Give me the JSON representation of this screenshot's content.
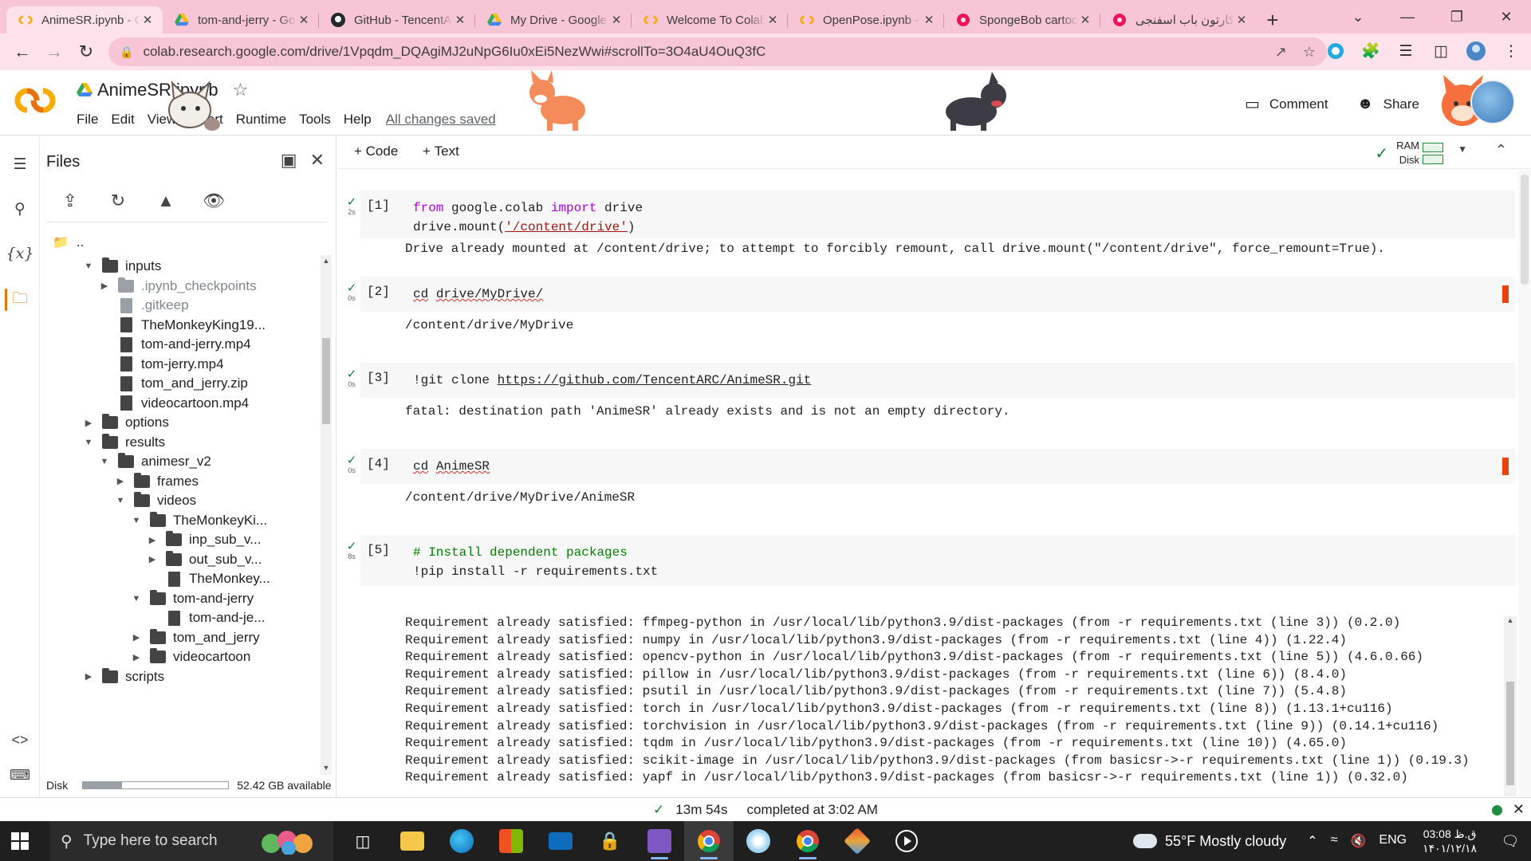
{
  "browser": {
    "tabs": [
      {
        "title": "AnimeSR.ipynb - Colaboratory",
        "icon": "colab-icon",
        "active": true
      },
      {
        "title": "tom-and-jerry - Google Drive",
        "icon": "google-drive-icon",
        "active": false
      },
      {
        "title": "GitHub - TencentARC/AnimeSR",
        "icon": "github-icon",
        "active": false
      },
      {
        "title": "My Drive - Google Drive",
        "icon": "google-drive-icon",
        "active": false
      },
      {
        "title": "Welcome To Colaboratory",
        "icon": "colab-icon",
        "active": false
      },
      {
        "title": "OpenPose.ipynb - Colaboratory",
        "icon": "colab-icon",
        "active": false
      },
      {
        "title": "SpongeBob cartoon",
        "icon": "aparat-icon",
        "active": false
      },
      {
        "title": "کارتون باب اسفنجی",
        "icon": "aparat-icon",
        "active": false
      }
    ],
    "tab_close_glyph": "✕",
    "new_tab_glyph": "+",
    "url": "colab.research.google.com/drive/1Vpqdm_DQAgiMJ2uNpG6Iu0xEi5NezWwi#scrollTo=3O4aU4OuQ3fC",
    "window_controls": [
      "⌄",
      "—",
      "❐",
      "✕"
    ]
  },
  "colab": {
    "notebook_title": "AnimeSR.ipynb",
    "menu": [
      "File",
      "Edit",
      "View",
      "Insert",
      "Runtime",
      "Tools",
      "Help"
    ],
    "save_status": "All changes saved",
    "comment_label": "Comment",
    "share_label": "Share",
    "add_code_label": "Code",
    "add_text_label": "Text",
    "ram_label": "RAM",
    "disk_label": "Disk",
    "accent_color": "#f9ab00"
  },
  "files_panel": {
    "title": "Files",
    "parent_dir": "..",
    "tree": [
      {
        "name": "inputs",
        "type": "folder",
        "depth": 0,
        "expanded": true
      },
      {
        "name": ".ipynb_checkpoints",
        "type": "folder",
        "depth": 1,
        "expanded": false,
        "dim": true
      },
      {
        "name": ".gitkeep",
        "type": "file",
        "depth": 1,
        "dim": true
      },
      {
        "name": "TheMonkeyKing19...",
        "type": "file",
        "depth": 1
      },
      {
        "name": "tom-and-jerry.mp4",
        "type": "file",
        "depth": 1
      },
      {
        "name": "tom-jerry.mp4",
        "type": "file",
        "depth": 1
      },
      {
        "name": "tom_and_jerry.zip",
        "type": "file",
        "depth": 1
      },
      {
        "name": "videocartoon.mp4",
        "type": "file",
        "depth": 1
      },
      {
        "name": "options",
        "type": "folder",
        "depth": 0,
        "expanded": false
      },
      {
        "name": "results",
        "type": "folder",
        "depth": 0,
        "expanded": true
      },
      {
        "name": "animesr_v2",
        "type": "folder",
        "depth": 1,
        "expanded": true
      },
      {
        "name": "frames",
        "type": "folder",
        "depth": 2,
        "expanded": false
      },
      {
        "name": "videos",
        "type": "folder",
        "depth": 2,
        "expanded": true
      },
      {
        "name": "TheMonkeyKi...",
        "type": "folder",
        "depth": 3,
        "expanded": true
      },
      {
        "name": "inp_sub_v...",
        "type": "folder",
        "depth": 4,
        "expanded": false
      },
      {
        "name": "out_sub_v...",
        "type": "folder",
        "depth": 4,
        "expanded": false
      },
      {
        "name": "TheMonkey...",
        "type": "file",
        "depth": 4
      },
      {
        "name": "tom-and-jerry",
        "type": "folder",
        "depth": 3,
        "expanded": true
      },
      {
        "name": "tom-and-je...",
        "type": "file",
        "depth": 4
      },
      {
        "name": "tom_and_jerry",
        "type": "folder",
        "depth": 3,
        "expanded": false
      },
      {
        "name": "videocartoon",
        "type": "folder",
        "depth": 3,
        "expanded": false
      },
      {
        "name": "scripts",
        "type": "folder",
        "depth": 0,
        "expanded": false
      }
    ],
    "disk_label": "Disk",
    "disk_available": "52.42 GB available",
    "disk_used_fraction": 0.27
  },
  "cells": [
    {
      "exec": "[1]",
      "time": "2s",
      "code_lines": [
        "from google.colab import drive",
        "drive.mount('/content/drive')"
      ],
      "output": "Drive already mounted at /content/drive; to attempt to forcibly remount, call drive.mount(\"/content/drive\", force_remount=True)."
    },
    {
      "exec": "[2]",
      "time": "0s",
      "code_lines": [
        "cd drive/MyDrive/"
      ],
      "output": "/content/drive/MyDrive"
    },
    {
      "exec": "[3]",
      "time": "0s",
      "code_lines": [
        "!git clone https://github.com/TencentARC/AnimeSR.git"
      ],
      "output": "fatal: destination path 'AnimeSR' already exists and is not an empty directory."
    },
    {
      "exec": "[4]",
      "time": "0s",
      "code_lines": [
        "cd AnimeSR"
      ],
      "output": "/content/drive/MyDrive/AnimeSR"
    },
    {
      "exec": "[5]",
      "time": "8s",
      "code_lines": [
        "# Install dependent packages",
        "!pip install -r requirements.txt"
      ],
      "output_lines": [
        "Requirement already satisfied: ffmpeg-python in /usr/local/lib/python3.9/dist-packages (from -r requirements.txt (line 3)) (0.2.0)",
        "Requirement already satisfied: numpy in /usr/local/lib/python3.9/dist-packages (from -r requirements.txt (line 4)) (1.22.4)",
        "Requirement already satisfied: opencv-python in /usr/local/lib/python3.9/dist-packages (from -r requirements.txt (line 5)) (4.6.0.66)",
        "Requirement already satisfied: pillow in /usr/local/lib/python3.9/dist-packages (from -r requirements.txt (line 6)) (8.4.0)",
        "Requirement already satisfied: psutil in /usr/local/lib/python3.9/dist-packages (from -r requirements.txt (line 7)) (5.4.8)",
        "Requirement already satisfied: torch in /usr/local/lib/python3.9/dist-packages (from -r requirements.txt (line 8)) (1.13.1+cu116)",
        "Requirement already satisfied: torchvision in /usr/local/lib/python3.9/dist-packages (from -r requirements.txt (line 9)) (0.14.1+cu116)",
        "Requirement already satisfied: tqdm in /usr/local/lib/python3.9/dist-packages (from -r requirements.txt (line 10)) (4.65.0)",
        "Requirement already satisfied: scikit-image in /usr/local/lib/python3.9/dist-packages (from basicsr->-r requirements.txt (line 1)) (0.19.3)",
        "Requirement already satisfied: yapf in /usr/local/lib/python3.9/dist-packages (from basicsr->-r requirements.txt (line 1)) (0.32.0)"
      ]
    }
  ],
  "status_bar": {
    "duration": "13m 54s",
    "completed": "completed at 3:02 AM"
  },
  "taskbar": {
    "search_placeholder": "Type here to search",
    "weather": "55°F  Mostly cloudy",
    "language": "ENG",
    "time": "03:08 ق.ظ",
    "date": "۱۴۰۱/۱۲/۱۸",
    "apps": [
      "task-view",
      "file-explorer",
      "edge",
      "microsoft-store",
      "mail",
      "lock-app",
      "visual-studio",
      "chrome",
      "paint",
      "chrome",
      "git",
      "media-player"
    ]
  }
}
